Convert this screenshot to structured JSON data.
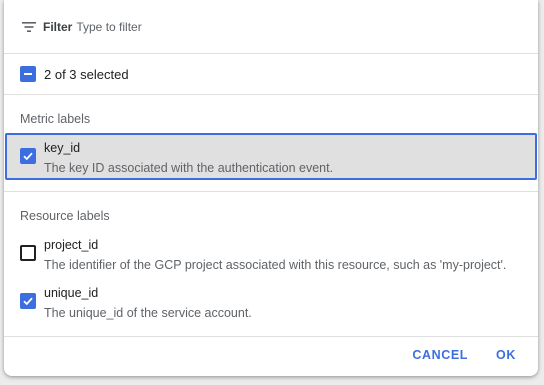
{
  "filter": {
    "label": "Filter",
    "placeholder": "Type to filter",
    "icon": "filter-list-icon"
  },
  "select_all": {
    "state": "indeterminate",
    "label": "2 of 3 selected"
  },
  "sections": {
    "metric": {
      "header": "Metric labels",
      "items": [
        {
          "title": "key_id",
          "description": "The key ID associated with the authentication event.",
          "checked": true,
          "focused": true
        }
      ]
    },
    "resource": {
      "header": "Resource labels",
      "items": [
        {
          "title": "project_id",
          "description": "The identifier of the GCP project associated with this resource, such as 'my-project'.",
          "checked": false
        },
        {
          "title": "unique_id",
          "description": "The unique_id of the service account.",
          "checked": true
        }
      ]
    }
  },
  "footer": {
    "cancel_label": "CANCEL",
    "ok_label": "OK"
  },
  "colors": {
    "accent": "#3d6ee0",
    "highlight_bg": "#e0e0e0",
    "text_primary": "#202124",
    "text_secondary": "#5f6368"
  }
}
